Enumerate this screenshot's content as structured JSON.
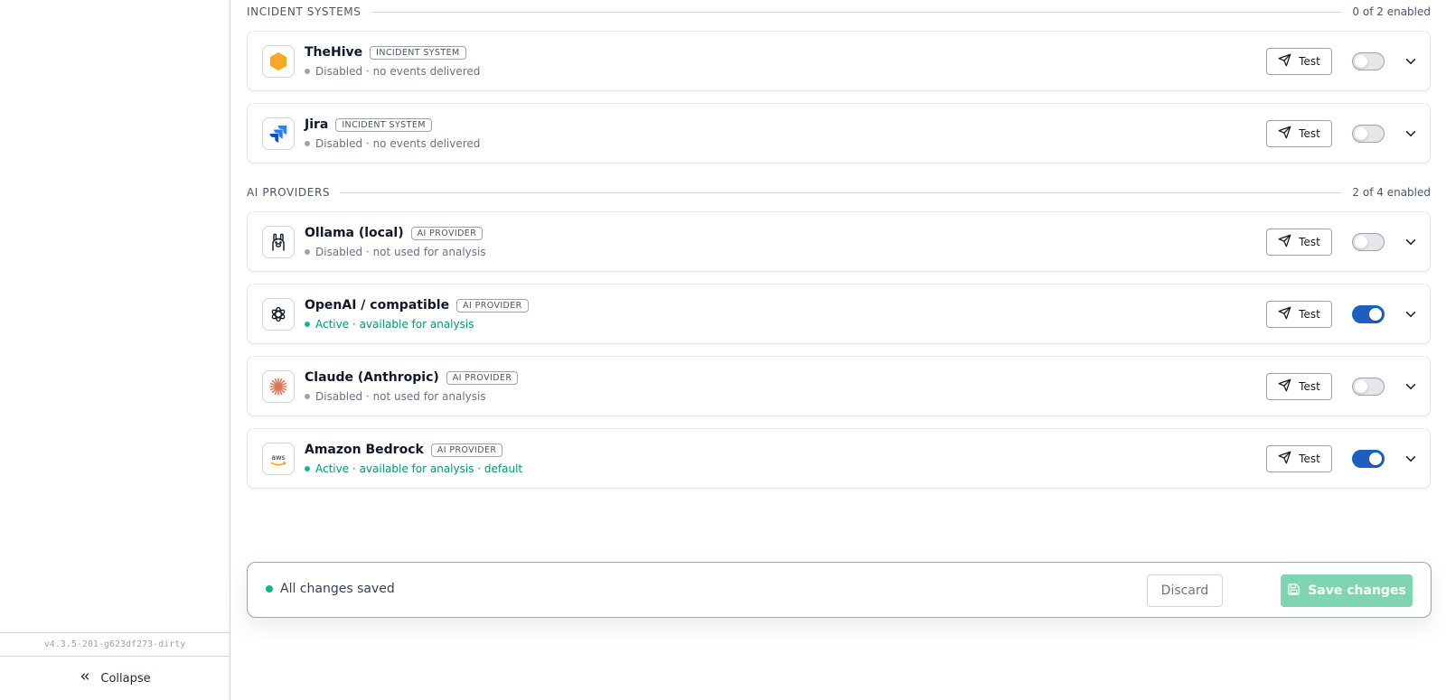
{
  "sidebar": {
    "version": "v4.3.5-201-g623df273-dirty",
    "collapse_label": "Collapse",
    "collapse_icon": "chevrons-left-icon"
  },
  "sections": [
    {
      "title": "INCIDENT SYSTEMS",
      "count": "0 of 2 enabled",
      "items": [
        {
          "name": "TheHive",
          "badge": "INCIDENT SYSTEM",
          "status": "Disabled · no events delivered",
          "enabled": false,
          "icon": "thehive-icon"
        },
        {
          "name": "Jira",
          "badge": "INCIDENT SYSTEM",
          "status": "Disabled · no events delivered",
          "enabled": false,
          "icon": "jira-icon"
        }
      ]
    },
    {
      "title": "AI PROVIDERS",
      "count": "2 of 4 enabled",
      "items": [
        {
          "name": "Ollama (local)",
          "badge": "AI PROVIDER",
          "status": "Disabled · not used for analysis",
          "enabled": false,
          "icon": "ollama-icon"
        },
        {
          "name": "OpenAI / compatible",
          "badge": "AI PROVIDER",
          "status": "Active · available for analysis",
          "enabled": true,
          "icon": "openai-icon"
        },
        {
          "name": "Claude (Anthropic)",
          "badge": "AI PROVIDER",
          "status": "Disabled · not used for analysis",
          "enabled": false,
          "icon": "claude-icon"
        },
        {
          "name": "Amazon Bedrock",
          "badge": "AI PROVIDER",
          "status": "Active · available for analysis · default",
          "enabled": true,
          "icon": "aws-icon"
        }
      ]
    }
  ],
  "test_label": "Test",
  "footer": {
    "status": "All changes saved",
    "discard_label": "Discard",
    "save_label": "Save changes"
  },
  "colors": {
    "toggle_on": "#1d5fbf",
    "active_status": "#059669",
    "save_button": "#7fd4b2"
  }
}
